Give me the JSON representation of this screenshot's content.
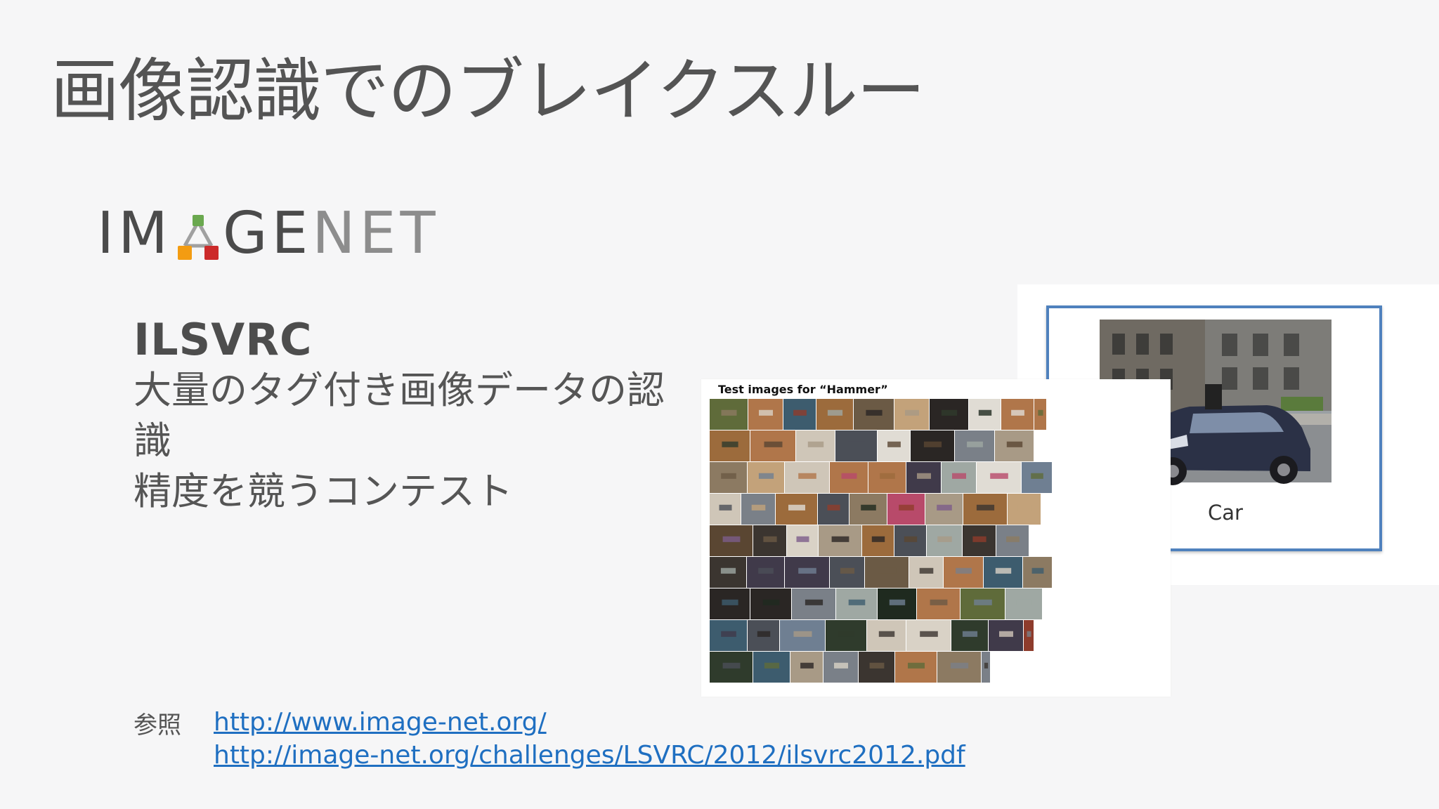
{
  "slide": {
    "title": "画像認識でのブレイクスルー",
    "logo": {
      "text_prefix": "IM",
      "text_suffix_dark": "GE",
      "text_suffix_fade": "NET",
      "mark_colors": [
        "#6aa84f",
        "#f39c12",
        "#cc2a2a"
      ]
    },
    "heading": "ILSVRC",
    "description_lines": [
      "大量のタグ付き画像データの認識",
      "精度を競うコンテスト"
    ],
    "reference": {
      "label": "参照",
      "links": [
        "http://www.image-net.org/",
        "http://image-net.org/challenges/LSVRC/2012/ilsvrc2012.pdf"
      ]
    },
    "figures": {
      "hammer_title": "Test images for “Hammer”",
      "car_caption": "Car"
    },
    "colors": {
      "link": "#1f6fc1",
      "frame_border": "#4f81bd",
      "background": "#f6f6f7"
    }
  }
}
